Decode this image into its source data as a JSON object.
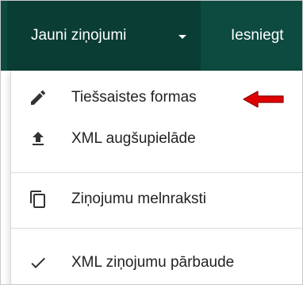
{
  "navbar": {
    "active_menu": "Jauni ziņojumi",
    "next_menu": "Iesniegt",
    "bg_color": "#0d4a40",
    "active_bg_color": "#0a3d34"
  },
  "dropdown": {
    "items": [
      {
        "label": "Tiešsaistes formas",
        "icon": "pencil-icon"
      },
      {
        "label": "XML augšupielāde",
        "icon": "upload-icon"
      },
      {
        "label": "Ziņojumu melnraksti",
        "icon": "copy-icon"
      },
      {
        "label": "XML ziņojumu pārbaude",
        "icon": "check-icon"
      }
    ]
  },
  "annotation": {
    "icon": "red-arrow-icon",
    "color": "#e00000"
  }
}
